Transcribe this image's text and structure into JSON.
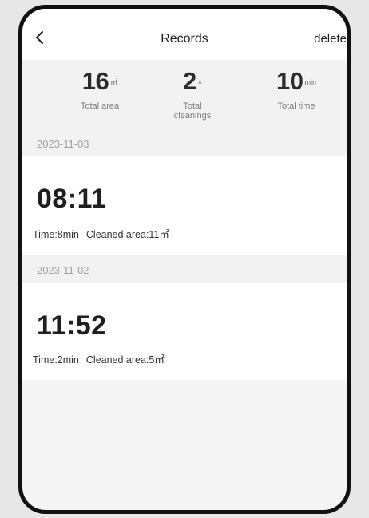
{
  "header": {
    "title": "Records",
    "delete_label": "delete",
    "back_icon": "chevron-left-icon"
  },
  "summary": {
    "area": {
      "value": "16",
      "unit": "㎡",
      "label": "Total area"
    },
    "cleanings": {
      "value": "2",
      "unit": "×",
      "label_line1": "Total",
      "label_line2": "cleanings"
    },
    "time": {
      "value": "10",
      "unit": "min",
      "label": "Total time"
    }
  },
  "records": [
    {
      "date": "2023-11-03",
      "time": "08:11",
      "duration": "Time:8min",
      "area": "Cleaned area:11㎡"
    },
    {
      "date": "2023-11-02",
      "time": "11:52",
      "duration": "Time:2min",
      "area": "Cleaned area:5㎡"
    }
  ]
}
